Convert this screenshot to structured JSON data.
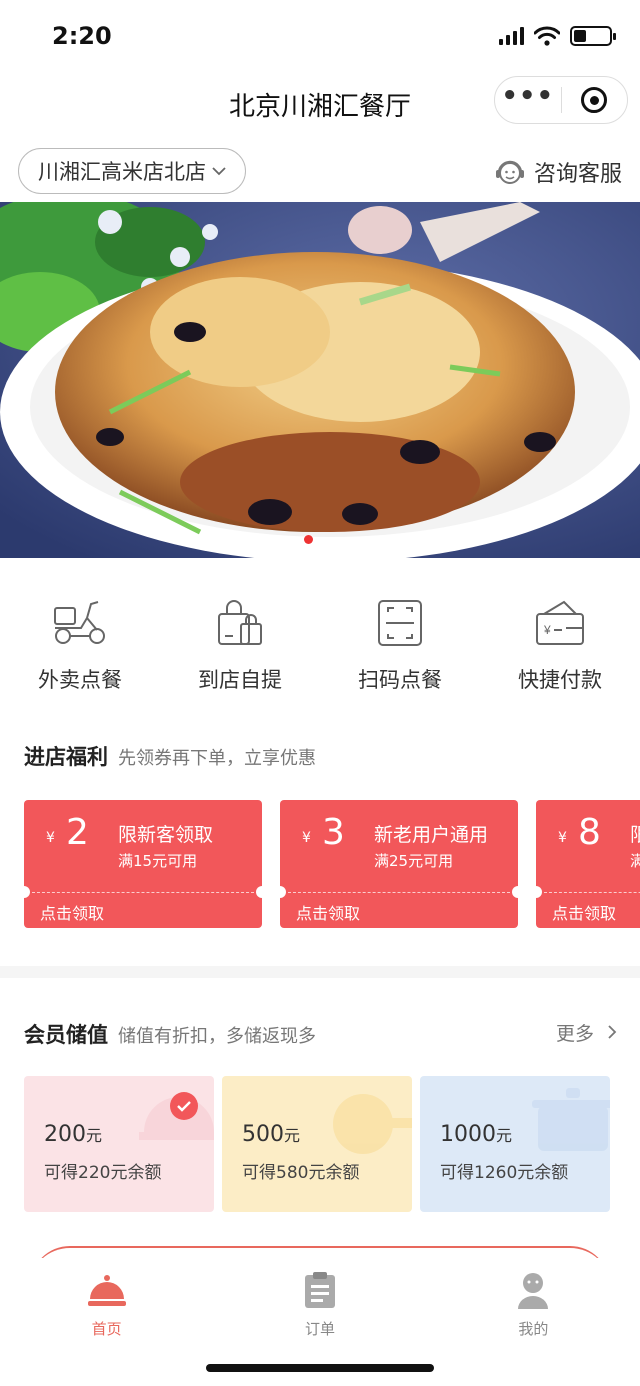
{
  "status_bar": {
    "time": "2:20",
    "battery_level": 0.35
  },
  "nav": {
    "title": "北京川湘汇餐厅"
  },
  "store": {
    "name": "川湘汇高米店北店",
    "consult_label": "咨询客服"
  },
  "actions": [
    {
      "label": "外卖点餐",
      "icon": "scooter-icon"
    },
    {
      "label": "到店自提",
      "icon": "shopping-bag-icon"
    },
    {
      "label": "扫码点餐",
      "icon": "scan-icon"
    },
    {
      "label": "快捷付款",
      "icon": "wallet-icon"
    }
  ],
  "welfare": {
    "title": "进店福利",
    "subtitle": "先领券再下单，立享优惠"
  },
  "coupons": [
    {
      "currency": "¥",
      "amount": "2",
      "title": "限新客领取",
      "condition": "满15元可用",
      "action": "点击领取"
    },
    {
      "currency": "¥",
      "amount": "3",
      "title": "新老用户通用",
      "condition": "满25元可用",
      "action": "点击领取"
    },
    {
      "currency": "¥",
      "amount": "8",
      "title": "限",
      "condition": "满",
      "action": "点击领取"
    }
  ],
  "membership": {
    "title": "会员储值",
    "subtitle": "储值有折扣，多储返现多",
    "more_label": "更多",
    "cards": [
      {
        "amount": "200",
        "unit": "元",
        "desc": "可得220元余额",
        "color": "#fbe3e6",
        "selected": true
      },
      {
        "amount": "500",
        "unit": "元",
        "desc": "可得580元余额",
        "color": "#fcedc6",
        "selected": false
      },
      {
        "amount": "1000",
        "unit": "元",
        "desc": "可得1260元余额",
        "color": "#dde9f7",
        "selected": false
      }
    ]
  },
  "tabbar": {
    "items": [
      {
        "label": "首页",
        "icon": "cloche-icon",
        "active": true
      },
      {
        "label": "订单",
        "icon": "order-list-icon",
        "active": false
      },
      {
        "label": "我的",
        "icon": "user-icon",
        "active": false
      }
    ]
  },
  "colors": {
    "accent": "#f2575a",
    "tab_active": "#e8685d"
  }
}
